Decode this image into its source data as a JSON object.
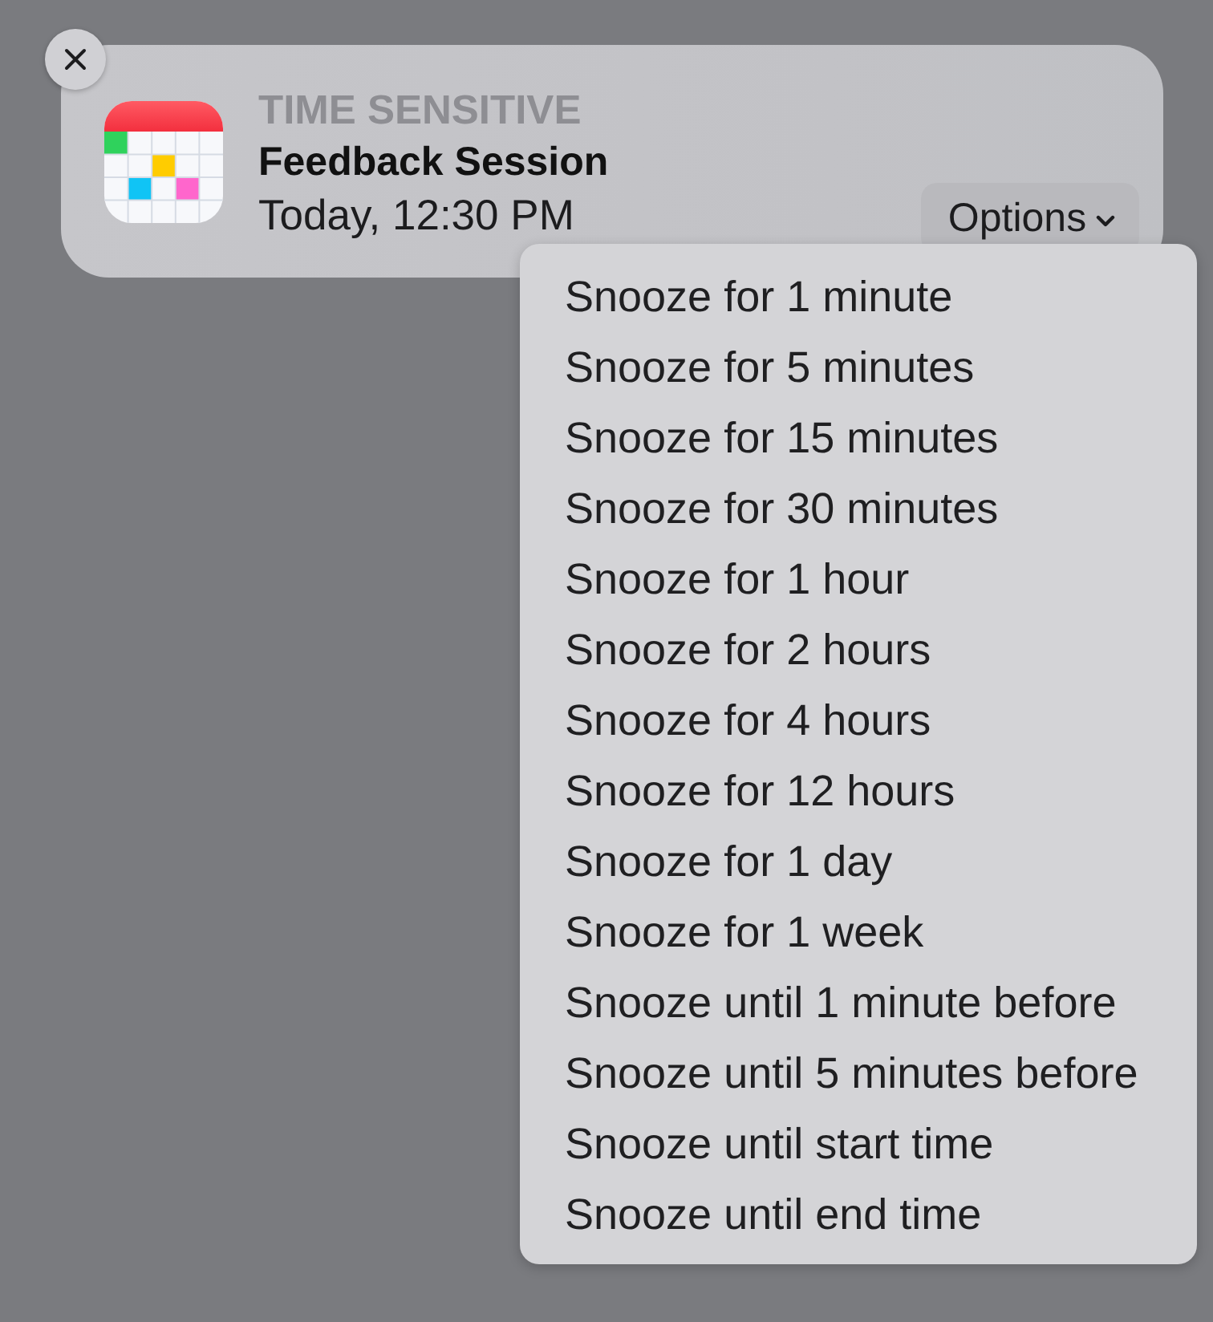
{
  "notification": {
    "category": "TIME SENSITIVE",
    "title": "Feedback Session",
    "time": "Today, 12:30 PM",
    "options_button": {
      "label": "Options",
      "expanded": true
    }
  },
  "options_menu": {
    "items": [
      {
        "label": "Snooze for 1 minute",
        "selected": false
      },
      {
        "label": "Snooze for 5 minutes",
        "selected": false
      },
      {
        "label": "Snooze for 15 minutes",
        "selected": false
      },
      {
        "label": "Snooze for 30 minutes",
        "selected": false
      },
      {
        "label": "Snooze for 1 hour",
        "selected": false
      },
      {
        "label": "Snooze for 2 hours",
        "selected": false
      },
      {
        "label": "Snooze for 4 hours",
        "selected": false
      },
      {
        "label": "Snooze for 12 hours",
        "selected": false
      },
      {
        "label": "Snooze for 1 day",
        "selected": false
      },
      {
        "label": "Snooze for 1 week",
        "selected": false
      },
      {
        "label": "Snooze until 1 minute before",
        "selected": false
      },
      {
        "label": "Snooze until 5 minutes before",
        "selected": false
      },
      {
        "label": "Snooze until start time",
        "selected": false
      },
      {
        "label": "Snooze until end time",
        "selected": false
      }
    ]
  }
}
